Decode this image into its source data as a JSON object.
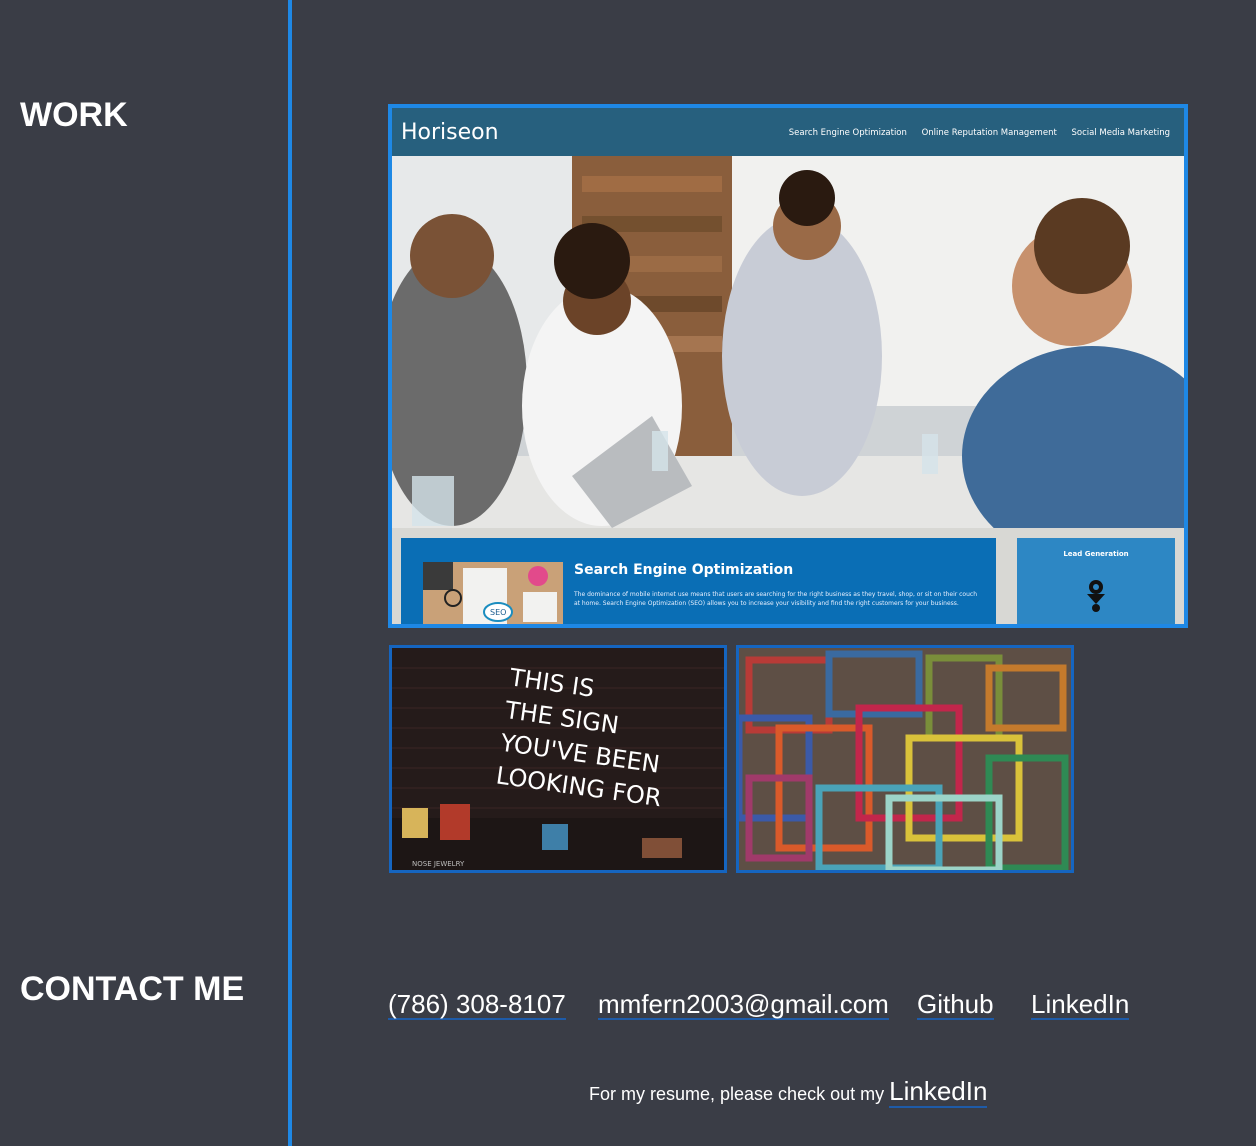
{
  "sections": {
    "work_title": "WORK",
    "contact_title": "CONTACT ME"
  },
  "project_main": {
    "logo": "Horiseon",
    "nav": [
      "Search Engine Optimization",
      "Online Reputation Management",
      "Social Media Marketing"
    ],
    "content_title": "Search Engine Optimization",
    "content_text": "The dominance of mobile internet use means that users are searching for the right business as they travel, shop, or sit on their couch at home. Search Engine Optimization (SEO) allows you to increase your visibility and find the right customers for your business.",
    "side_title": "Lead Generation",
    "thumb_label": "SEO"
  },
  "project_neon": {
    "sign_lines": [
      "THIS IS",
      "THE SIGN",
      "YOU'VE BEEN",
      "LOOKING FOR"
    ],
    "shop_label": "NOSE JEWELRY"
  },
  "contact": {
    "phone": "(786) 308-8107",
    "email": "mmfern2003@gmail.com",
    "github": "Github",
    "linkedin": "LinkedIn"
  },
  "resume": {
    "text": "For my resume, please check out my",
    "link": "LinkedIn"
  },
  "colors": {
    "background": "#3a3d46",
    "accent": "#1e88e5",
    "card_header": "#27607e",
    "card_content": "#0a6eb5"
  }
}
